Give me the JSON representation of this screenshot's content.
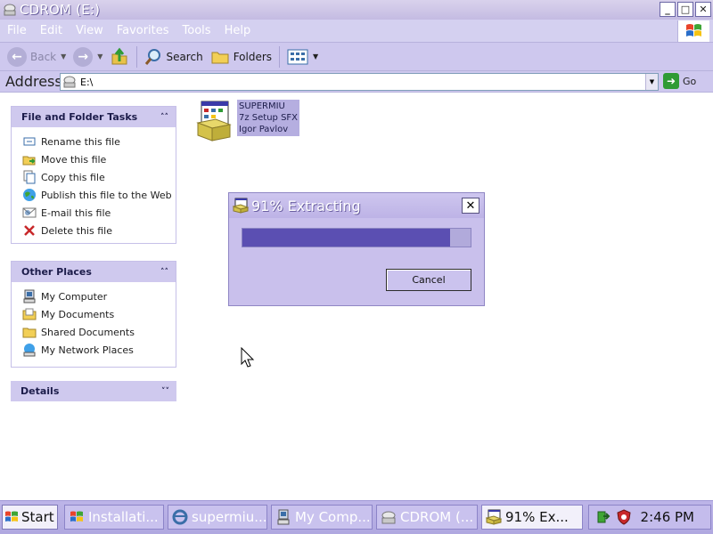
{
  "window": {
    "title": "CDROM (E:)",
    "buttons": [
      "_",
      "□",
      "✕"
    ]
  },
  "menu": [
    "File",
    "Edit",
    "View",
    "Favorites",
    "Tools",
    "Help"
  ],
  "toolbar": {
    "back_label": "Back",
    "search_label": "Search",
    "folders_label": "Folders"
  },
  "address": {
    "label": "Address",
    "value": "E:\\",
    "go_label": "Go"
  },
  "tasks_panel": {
    "title": "File and Folder Tasks",
    "items": [
      {
        "label": "Rename this file",
        "icon": "rename-icon"
      },
      {
        "label": "Move this file",
        "icon": "move-icon"
      },
      {
        "label": "Copy this file",
        "icon": "copy-icon"
      },
      {
        "label": "Publish this file to the Web",
        "icon": "publish-web-icon"
      },
      {
        "label": "E-mail this file",
        "icon": "email-icon"
      },
      {
        "label": "Delete this file",
        "icon": "delete-icon"
      }
    ]
  },
  "places_panel": {
    "title": "Other Places",
    "items": [
      {
        "label": "My Computer",
        "icon": "computer-icon"
      },
      {
        "label": "My Documents",
        "icon": "documents-icon"
      },
      {
        "label": "Shared Documents",
        "icon": "shared-folder-icon"
      },
      {
        "label": "My Network Places",
        "icon": "network-icon"
      }
    ]
  },
  "details_panel": {
    "title": "Details"
  },
  "file": {
    "line1": "SUPERMIU",
    "line2": "7z Setup SFX",
    "line3": "Igor Pavlov"
  },
  "dialog": {
    "title": "91% Extracting",
    "progress_percent": 91,
    "close_label": "✕",
    "cancel_label": "Cancel"
  },
  "taskbar": {
    "start_label": "Start",
    "items": [
      {
        "label": "Installati..."
      },
      {
        "label": "supermiu..."
      },
      {
        "label": "My Comp..."
      },
      {
        "label": "CDROM (..."
      },
      {
        "label": "91% Ex..."
      }
    ],
    "clock": "2:46 PM"
  },
  "colors": {
    "accent": "#c4bbe2",
    "progress_fill": "#5b4fb2",
    "panel_header": "#cfc9ee"
  }
}
